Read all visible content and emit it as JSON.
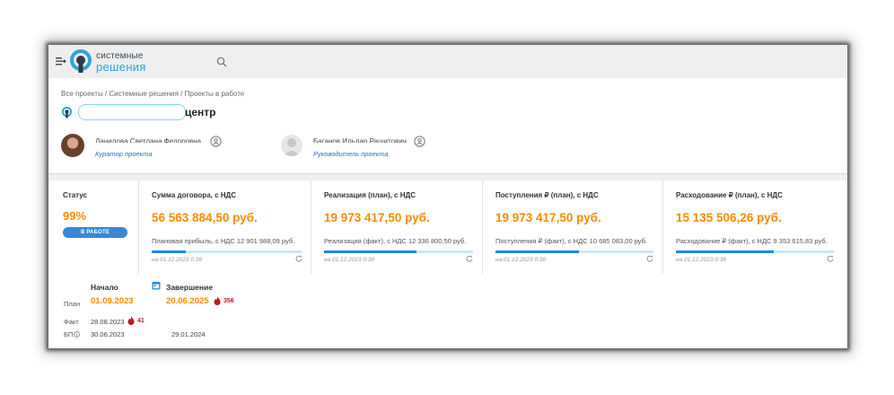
{
  "app": {
    "logo_line1": "системные",
    "logo_line2": "решения",
    "brand_color": "#2aa6d8"
  },
  "breadcrumb": [
    "Все проекты",
    "Системные решения",
    "Проекты в работе"
  ],
  "breadcrumb_sep": " / ",
  "project": {
    "title_suffix": "центр"
  },
  "people": [
    {
      "name": "Данилова Светлана Федоровна",
      "role": "Куратор проекта"
    },
    {
      "name": "Баганов Ильдар Рашитович",
      "role": "Руководитель проекта"
    }
  ],
  "status": {
    "title": "Статус",
    "value": "99%",
    "badge": "В РАБОТЕ"
  },
  "cards": [
    {
      "title": "Сумма договора, с НДС",
      "value": "56 563 884,50 руб.",
      "sub": "Плановая прибыль, с НДС  12 901 988,09 руб.",
      "progress": 0.23,
      "date": "на 01.12.2023 0:38"
    },
    {
      "title": "Реализация (план), с НДС",
      "value": "19 973 417,50 руб.",
      "sub": "Реализация (факт), с НДС  12 336 800,50 руб.",
      "progress": 0.62,
      "date": "на 01.12.2023 0:38"
    },
    {
      "title": "Поступления ₽ (план), с НДС",
      "value": "19 973 417,50 руб.",
      "sub": "Поступления ₽ (факт), с НДС  10 685 083,00 руб.",
      "progress": 0.53,
      "date": "на 01.12.2023 0:38"
    },
    {
      "title": "Расходование ₽ (план), с НДС",
      "value": "15 135 506,26 руб.",
      "sub": "Расходование ₽ (факт), с НДС  9 353 615,83 руб.",
      "progress": 0.62,
      "date": "на 01.12.2023 0:38"
    }
  ],
  "schedule": {
    "start_label": "Начало",
    "end_label": "Завершение",
    "rows": {
      "plan_label": "План",
      "fact_label": "Факт",
      "bp_label": "БП"
    },
    "plan_start": "01.09.2023",
    "plan_end": "20.06.2025",
    "plan_end_overdue": "356",
    "fact_start": "28.08.2023",
    "fact_start_overdue": "41",
    "bp_start": "30.06.2023",
    "bp_end": "29.01.2024"
  },
  "colors": {
    "accent": "#ff8a00",
    "primary": "#1e88e5",
    "progress_track": "#c9e8f8",
    "badge": "#3b86d6",
    "link": "#2f6bc4",
    "overdue": "#b71c1c"
  }
}
